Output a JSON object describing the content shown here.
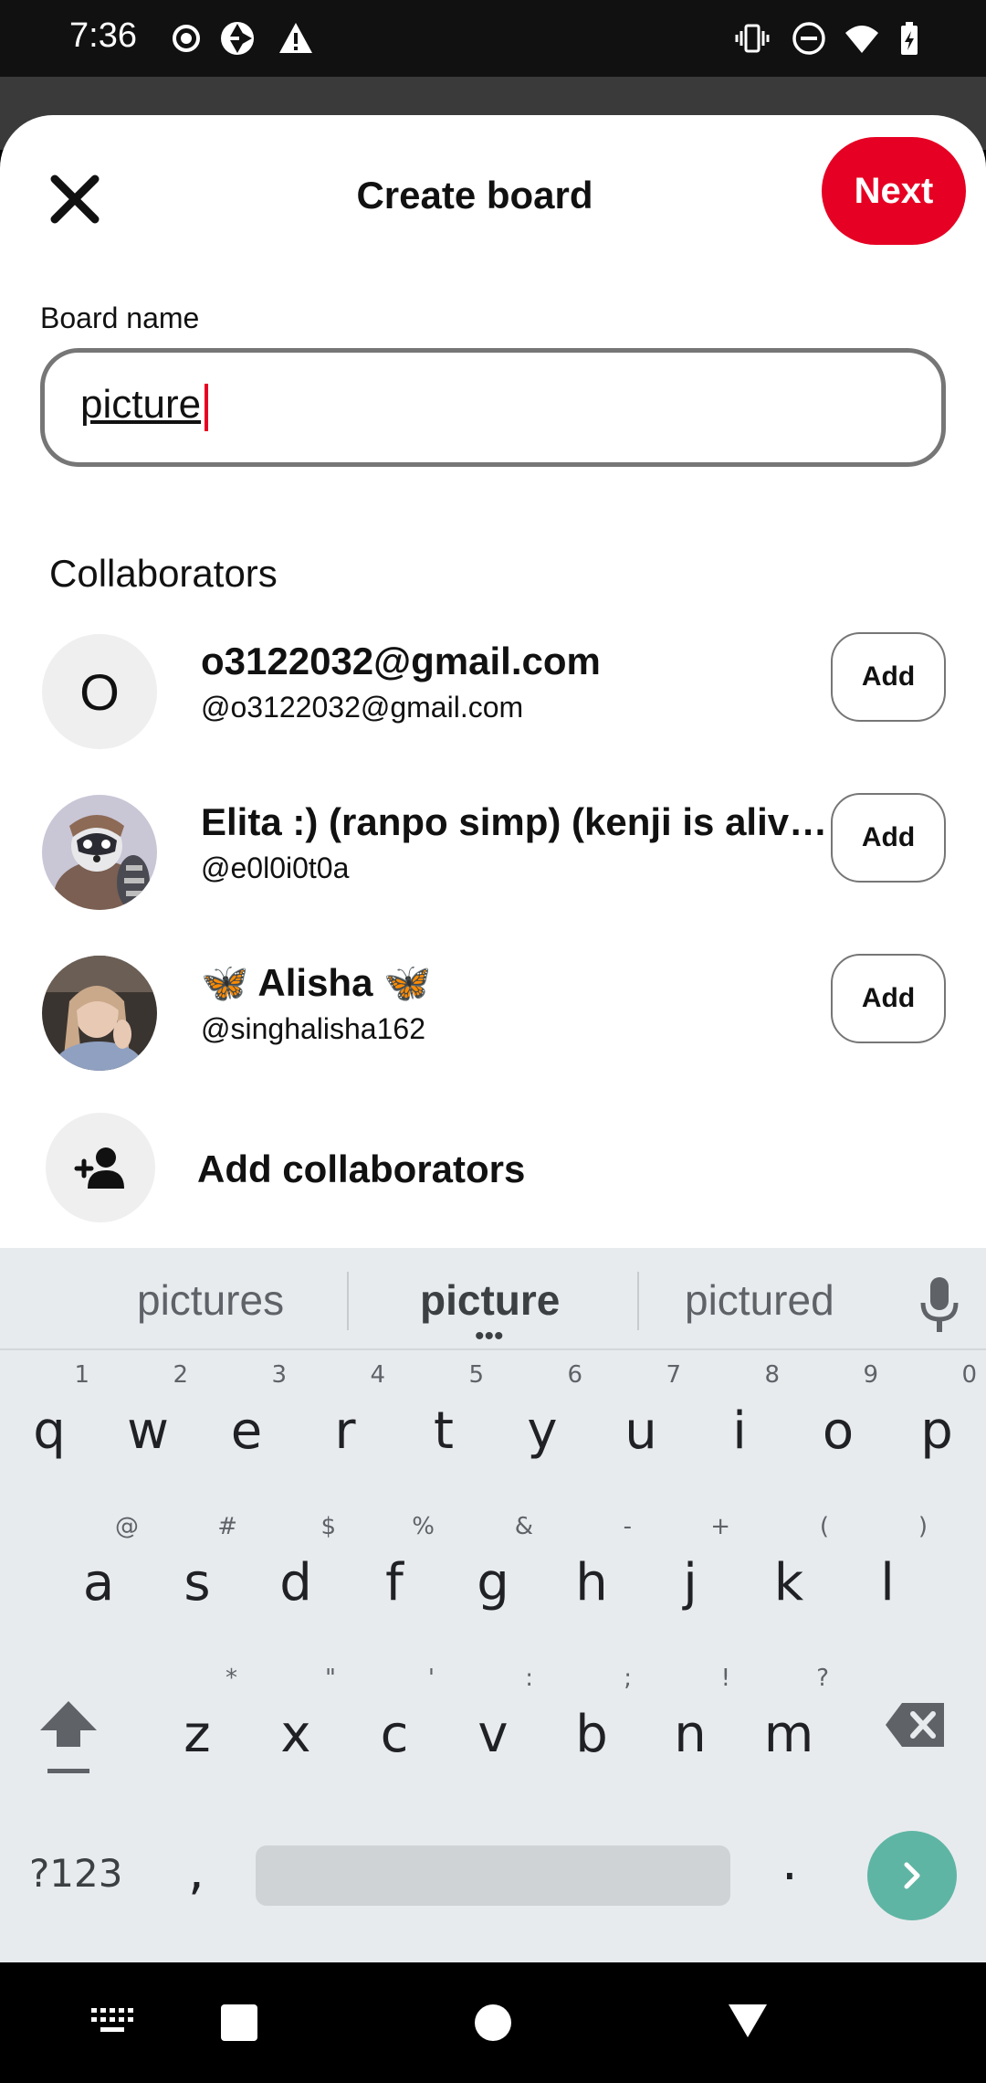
{
  "status_bar": {
    "time": "7:36"
  },
  "header": {
    "title": "Create board",
    "next_label": "Next"
  },
  "form": {
    "board_name_label": "Board name",
    "board_name_value": "picture"
  },
  "collaborators": {
    "section_title": "Collaborators",
    "items": [
      {
        "avatar_letter": "O",
        "name": "o3122032@gmail.com",
        "handle": "@o3122032@gmail.com",
        "add_label": "Add"
      },
      {
        "avatar_letter": "",
        "name": "Elita :) (ranpo simp) (kenji is alive…",
        "handle": "@e0l0i0t0a",
        "add_label": "Add"
      },
      {
        "avatar_letter": "",
        "name": "🦋 Alisha 🦋",
        "handle": "@singhalisha162",
        "add_label": "Add"
      }
    ],
    "add_collaborators_label": "Add collaborators"
  },
  "keyboard": {
    "suggestions": [
      "pictures",
      "picture",
      "pictured"
    ],
    "row1": [
      {
        "k": "q",
        "h": "1"
      },
      {
        "k": "w",
        "h": "2"
      },
      {
        "k": "e",
        "h": "3"
      },
      {
        "k": "r",
        "h": "4"
      },
      {
        "k": "t",
        "h": "5"
      },
      {
        "k": "y",
        "h": "6"
      },
      {
        "k": "u",
        "h": "7"
      },
      {
        "k": "i",
        "h": "8"
      },
      {
        "k": "o",
        "h": "9"
      },
      {
        "k": "p",
        "h": "0"
      }
    ],
    "row2": [
      {
        "k": "a",
        "h": "@"
      },
      {
        "k": "s",
        "h": "#"
      },
      {
        "k": "d",
        "h": "$"
      },
      {
        "k": "f",
        "h": "%"
      },
      {
        "k": "g",
        "h": "&"
      },
      {
        "k": "h",
        "h": "-"
      },
      {
        "k": "j",
        "h": "+"
      },
      {
        "k": "k",
        "h": "("
      },
      {
        "k": "l",
        "h": ")"
      }
    ],
    "row3": [
      {
        "k": "z",
        "h": "*"
      },
      {
        "k": "x",
        "h": "\""
      },
      {
        "k": "c",
        "h": "'"
      },
      {
        "k": "v",
        "h": ":"
      },
      {
        "k": "b",
        "h": ";"
      },
      {
        "k": "n",
        "h": "!"
      },
      {
        "k": "m",
        "h": "?"
      }
    ],
    "symbols_label": "?123",
    "comma": ",",
    "period": "."
  },
  "colors": {
    "brand": "#e60023",
    "enter": "#5fb5a4"
  }
}
